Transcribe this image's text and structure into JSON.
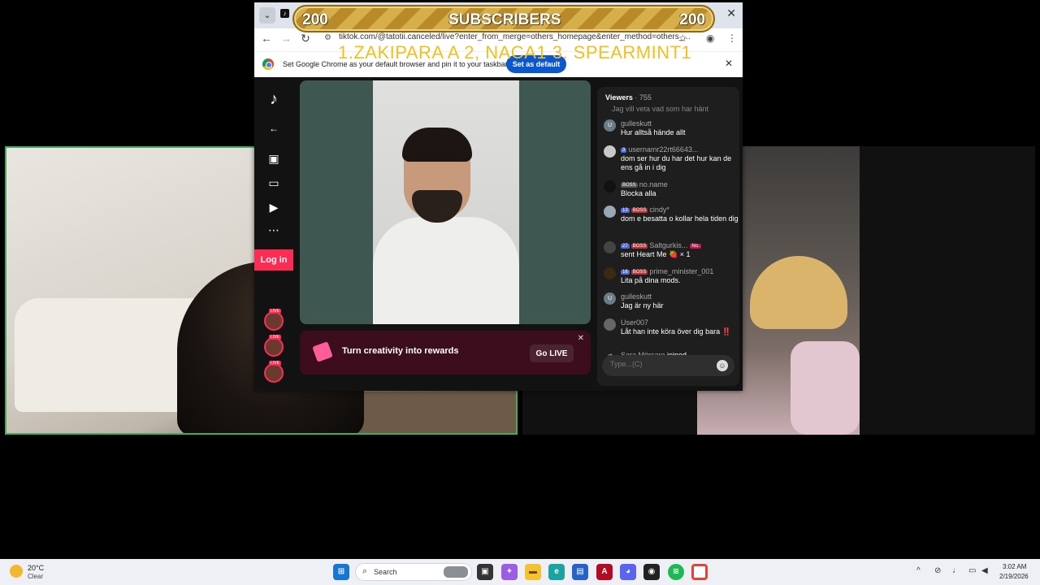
{
  "overlay": {
    "subscribers_left": "200",
    "subscribers_label": "SUBSCRIBERS",
    "subscribers_right": "200",
    "ticker": "1.ZAKIPARA A 2, NACA1  3.  SPEARMINT1"
  },
  "browser": {
    "url": "tiktok.com/@tatotii.canceled/live?enter_from_merge=others_homepage&enter_method=others_...",
    "infobar_text": "Set Google Chrome as your default browser and pin it to your taskbar",
    "set_default_label": "Set as default"
  },
  "tiktok": {
    "login_label": "Log in",
    "promo_text": "Turn creativity into rewards",
    "go_live_label": "Go LIVE",
    "live_badge": "LIVE",
    "viewers_label": "Viewers",
    "viewers_count": "· 755",
    "chat_partial": "Jag vill veta vad som har hänt",
    "chat_input_placeholder": "Type...(C)",
    "chat": [
      {
        "name": "gulleskutt",
        "text": "Hur alltså hände allt",
        "avatar": "U",
        "badges": []
      },
      {
        "name": "usernamr22rt66643...",
        "text": "dom ser hur du har det hur kan de ens gå in i dig",
        "avatar": "",
        "badges": [
          {
            "kind": "lvl",
            "label": "3"
          }
        ]
      },
      {
        "name": "no.name",
        "text": "Blocka alla",
        "avatar": "",
        "badges": [
          {
            "kind": "mod",
            "label": "BOSS"
          }
        ]
      },
      {
        "name": "cindy*",
        "text": "dom e besatta o kollar hela tiden dig",
        "avatar": "",
        "badges": [
          {
            "kind": "lvl",
            "label": "13"
          },
          {
            "kind": "boss",
            "label": "BOSS"
          }
        ]
      },
      {
        "name": "Saltgurkis...",
        "text": "sent Heart Me 🍓 × 1",
        "avatar": "",
        "badges": [
          {
            "kind": "lvl",
            "label": "27"
          },
          {
            "kind": "boss",
            "label": "BOSS"
          }
        ],
        "extra": "No."
      },
      {
        "name": "prime_minister_001",
        "text": "Lita på dina mods.",
        "avatar": "",
        "badges": [
          {
            "kind": "lvl",
            "label": "16"
          },
          {
            "kind": "boss",
            "label": "BOSS"
          }
        ]
      },
      {
        "name": "gulleskutt",
        "text": "Jag är ny här",
        "avatar": "U",
        "badges": []
      },
      {
        "name": "User007",
        "text": "Låt han inte köra över dig bara ‼️",
        "avatar": "",
        "badges": []
      }
    ],
    "joined_name": "Sara Mörsare",
    "joined_text": "joined"
  },
  "taskbar": {
    "temperature": "20°C",
    "weather": "Clear",
    "search_label": "Search",
    "time": "3:02 AM",
    "date": "2/19/2026"
  }
}
